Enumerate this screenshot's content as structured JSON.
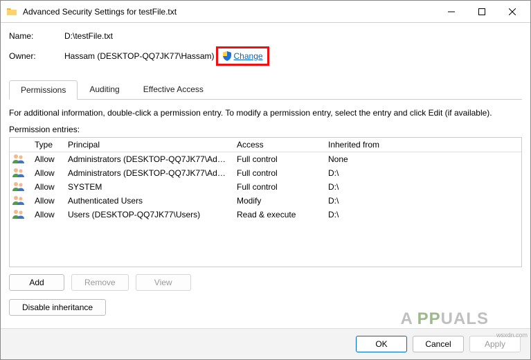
{
  "window": {
    "title": "Advanced Security Settings for testFile.txt"
  },
  "fields": {
    "name_label": "Name:",
    "name_value": "D:\\testFile.txt",
    "owner_label": "Owner:",
    "owner_value": "Hassam (DESKTOP-QQ7JK77\\Hassam)",
    "change_link": "Change"
  },
  "tabs": {
    "permissions": "Permissions",
    "auditing": "Auditing",
    "effective": "Effective Access"
  },
  "info_text": "For additional information, double-click a permission entry. To modify a permission entry, select the entry and click Edit (if available).",
  "entries_label": "Permission entries:",
  "table": {
    "headers": {
      "type": "Type",
      "principal": "Principal",
      "access": "Access",
      "inherited": "Inherited from"
    },
    "rows": [
      {
        "type": "Allow",
        "principal": "Administrators (DESKTOP-QQ7JK77\\Admini...",
        "access": "Full control",
        "inherited": "None"
      },
      {
        "type": "Allow",
        "principal": "Administrators (DESKTOP-QQ7JK77\\Admini...",
        "access": "Full control",
        "inherited": "D:\\"
      },
      {
        "type": "Allow",
        "principal": "SYSTEM",
        "access": "Full control",
        "inherited": "D:\\"
      },
      {
        "type": "Allow",
        "principal": "Authenticated Users",
        "access": "Modify",
        "inherited": "D:\\"
      },
      {
        "type": "Allow",
        "principal": "Users (DESKTOP-QQ7JK77\\Users)",
        "access": "Read & execute",
        "inherited": "D:\\"
      }
    ]
  },
  "buttons": {
    "add": "Add",
    "remove": "Remove",
    "view": "View",
    "disable_inheritance": "Disable inheritance",
    "ok": "OK",
    "cancel": "Cancel",
    "apply": "Apply"
  },
  "watermark": "A PPUALS",
  "corner": "wsxdn.com"
}
